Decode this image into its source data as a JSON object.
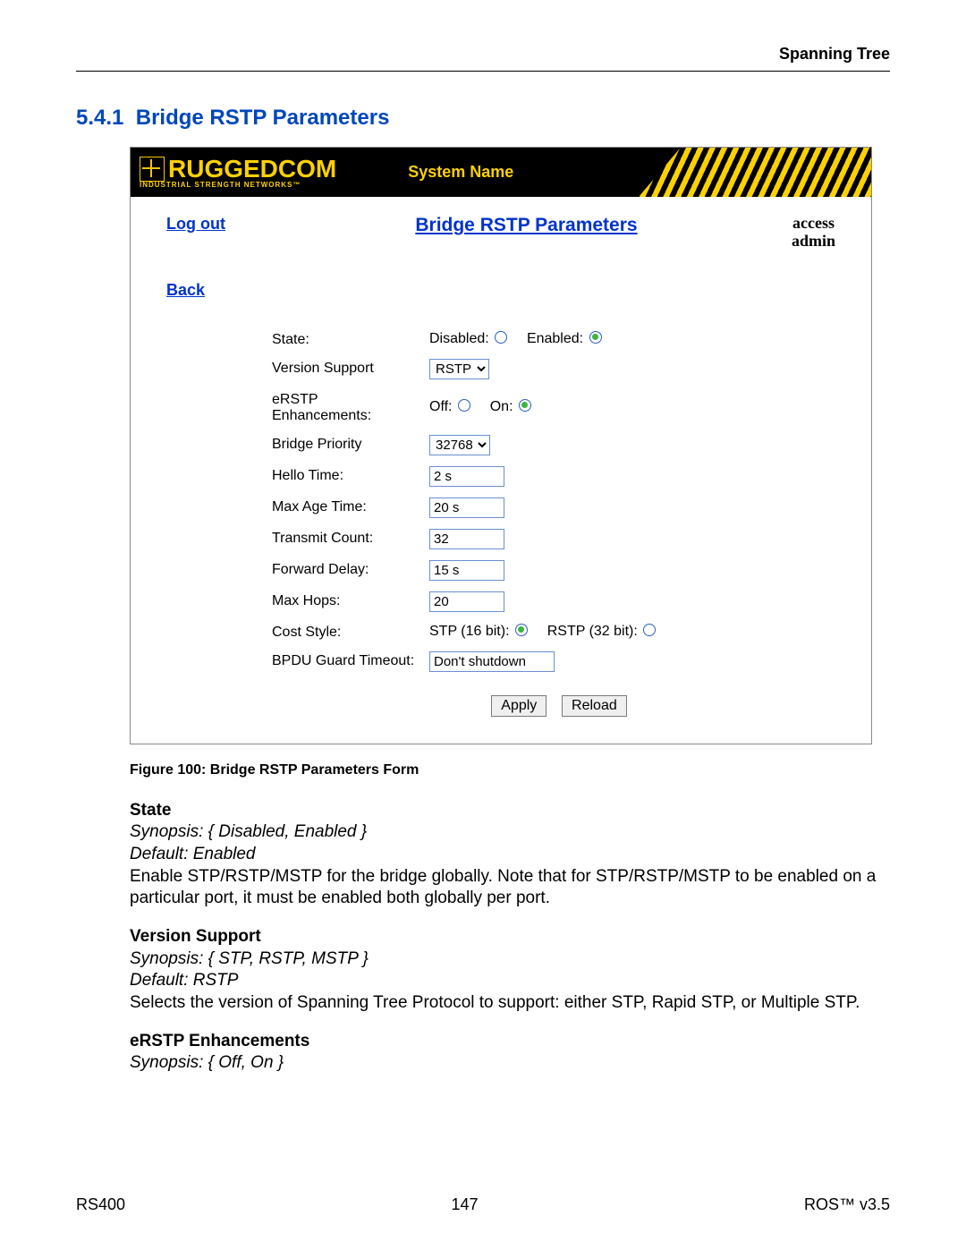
{
  "header": {
    "chapter": "Spanning Tree"
  },
  "section": {
    "number": "5.4.1",
    "title": "Bridge RSTP Parameters"
  },
  "ui": {
    "brand": {
      "name": "RUGGEDCOM",
      "tagline": "INDUSTRIAL STRENGTH NETWORKS™"
    },
    "system_name": "System Name",
    "nav": {
      "logout": "Log out",
      "back": "Back"
    },
    "page_title": "Bridge RSTP Parameters",
    "access": {
      "line1": "access",
      "line2": "admin"
    },
    "form": {
      "state": {
        "label": "State:",
        "opt_disabled": "Disabled:",
        "opt_enabled": "Enabled:",
        "value": "Enabled"
      },
      "version_support": {
        "label": "Version Support",
        "options": [
          "RSTP"
        ],
        "value": "RSTP"
      },
      "erstp": {
        "label": "eRSTP Enhancements:",
        "opt_off": "Off:",
        "opt_on": "On:",
        "value": "On"
      },
      "bridge_priority": {
        "label": "Bridge Priority",
        "options": [
          "32768"
        ],
        "value": "32768"
      },
      "hello_time": {
        "label": "Hello Time:",
        "value": "2 s"
      },
      "max_age": {
        "label": "Max Age Time:",
        "value": "20 s"
      },
      "transmit_count": {
        "label": "Transmit Count:",
        "value": "32"
      },
      "forward_delay": {
        "label": "Forward Delay:",
        "value": "15 s"
      },
      "max_hops": {
        "label": "Max Hops:",
        "value": "20"
      },
      "cost_style": {
        "label": "Cost Style:",
        "opt_stp": "STP (16 bit):",
        "opt_rstp": "RSTP (32 bit):",
        "value": "STP (16 bit)"
      },
      "bpdu": {
        "label": "BPDU Guard Timeout:",
        "value": "Don't shutdown"
      }
    },
    "buttons": {
      "apply": "Apply",
      "reload": "Reload"
    }
  },
  "caption": "Figure 100: Bridge RSTP Parameters Form",
  "descriptions": {
    "state": {
      "heading": "State",
      "synopsis": "Synopsis: { Disabled, Enabled }",
      "default": "Default: Enabled",
      "body": "Enable STP/RSTP/MSTP for the bridge globally. Note that for STP/RSTP/MSTP to be enabled on a particular port, it must be enabled both globally per port."
    },
    "version_support": {
      "heading": "Version Support",
      "synopsis": "Synopsis: { STP, RSTP, MSTP }",
      "default": "Default: RSTP",
      "body": "Selects the version of Spanning Tree Protocol to support: either STP, Rapid STP, or Multiple STP."
    },
    "erstp": {
      "heading": "eRSTP Enhancements",
      "synopsis": "Synopsis: { Off, On }"
    }
  },
  "footer": {
    "left": "RS400",
    "center": "147",
    "right": "ROS™  v3.5"
  }
}
